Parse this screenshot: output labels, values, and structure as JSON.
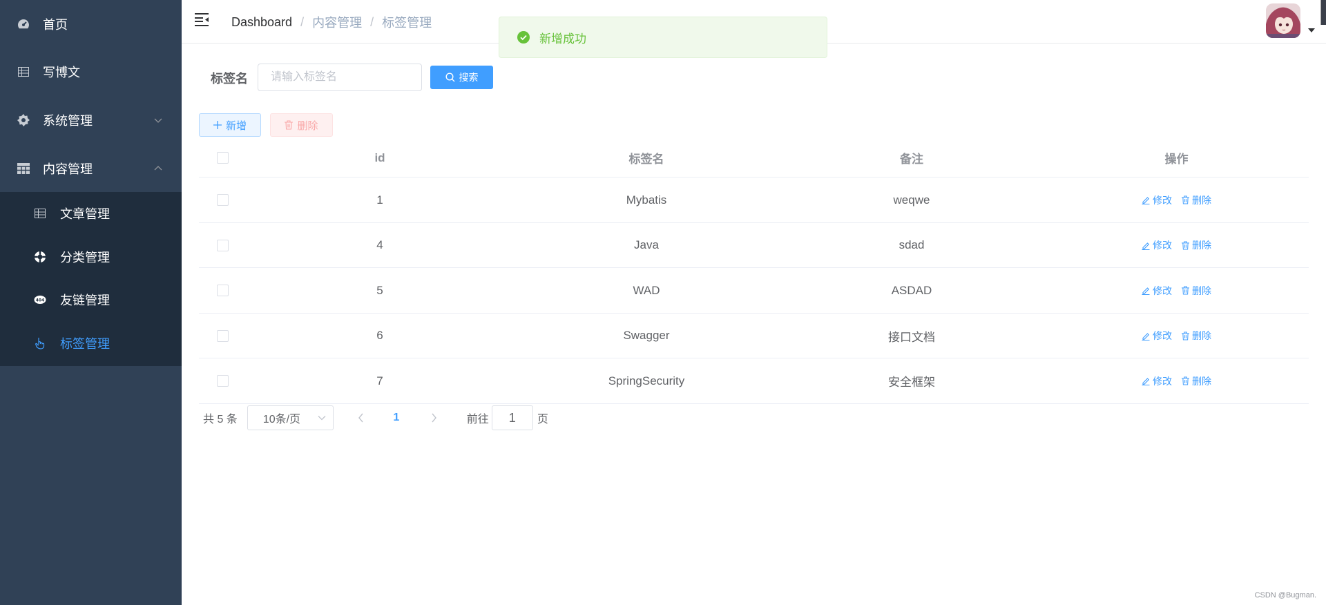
{
  "sidebar": {
    "items": [
      {
        "label": "首页",
        "icon": "dashboard-icon"
      },
      {
        "label": "写博文",
        "icon": "table-icon"
      },
      {
        "label": "系统管理",
        "icon": "gear-icon",
        "expanded": false
      },
      {
        "label": "内容管理",
        "icon": "grid-icon",
        "expanded": true
      }
    ],
    "sub_items": [
      {
        "label": "文章管理",
        "icon": "table-icon"
      },
      {
        "label": "分类管理",
        "icon": "lifebuoy-icon"
      },
      {
        "label": "友链管理",
        "icon": "link-icon"
      },
      {
        "label": "标签管理",
        "icon": "hand-pointer-icon",
        "active": true
      }
    ],
    "bg_color": "#304156",
    "sub_bg_color": "#1f2d3d",
    "active_color": "#409eff"
  },
  "header": {
    "breadcrumb": [
      "Dashboard",
      "内容管理",
      "标签管理"
    ],
    "breadcrumb_separator": "/"
  },
  "toast": {
    "message": "新增成功",
    "type": "success",
    "color": "#67c23a"
  },
  "search": {
    "label": "标签名",
    "placeholder": "请输入标签名",
    "value": "",
    "button_label": "搜索"
  },
  "toolbar": {
    "add_label": "新增",
    "delete_label": "删除"
  },
  "table": {
    "columns": [
      "id",
      "标签名",
      "备注",
      "操作"
    ],
    "rows": [
      {
        "id": "1",
        "name": "Mybatis",
        "remark": "weqwe"
      },
      {
        "id": "4",
        "name": "Java",
        "remark": "sdad"
      },
      {
        "id": "5",
        "name": "WAD",
        "remark": "ASDAD"
      },
      {
        "id": "6",
        "name": "Swagger",
        "remark": "接口文档"
      },
      {
        "id": "7",
        "name": "SpringSecurity",
        "remark": "安全框架"
      }
    ],
    "edit_label": "修改",
    "delete_label": "删除"
  },
  "pagination": {
    "total_text": "共 5 条",
    "page_size": "10条/页",
    "current_page": "1",
    "goto_label": "前往",
    "goto_value": "1",
    "page_suffix": "页"
  },
  "watermark": "CSDN @Bugman."
}
